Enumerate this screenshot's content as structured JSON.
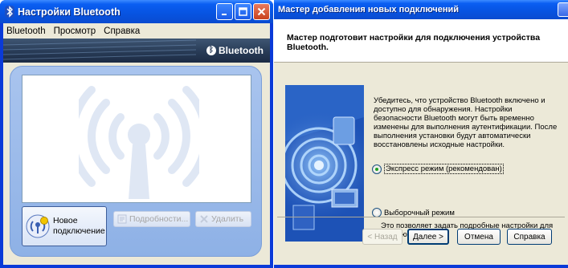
{
  "settings_window": {
    "title": "Настройки Bluetooth",
    "title_buttons": [
      "minimize-icon",
      "maximize-icon",
      "close-icon"
    ],
    "menu": [
      "Bluetooth",
      "Просмотр",
      "Справка"
    ],
    "banner_logo": "Bluetooth",
    "actions": {
      "new_connection": "Новое подключение",
      "new_connection_line1": "Новое",
      "new_connection_line2": "подключение",
      "details": "Подробности...",
      "remove": "Удалить"
    },
    "colors": {
      "title_bar": "#0a5ef2",
      "panel": "#9ebbea"
    }
  },
  "wizard_window": {
    "title": "Мастер добавления новых подключений",
    "heading": "Мастер подготовит настройки для подключения устройства Bluetooth.",
    "description": "Убедитесь, что устройство Bluetooth включено и доступно для обнаружения. Настройки безопасности Bluetooth могут быть временно изменены для выполнения аутентификации. После выполнения установки будут автоматически восстановлены исходные настройки.",
    "options": [
      {
        "label": "Экспресс режим (рекомендован)",
        "selected": true
      },
      {
        "label": "Выборочный режим",
        "selected": false
      }
    ],
    "custom_note": "Это позволяет задать подробные настройки для подключения.",
    "buttons": {
      "back": "< Назад",
      "next": "Далее >",
      "cancel": "Отмена",
      "help": "Справка"
    }
  }
}
